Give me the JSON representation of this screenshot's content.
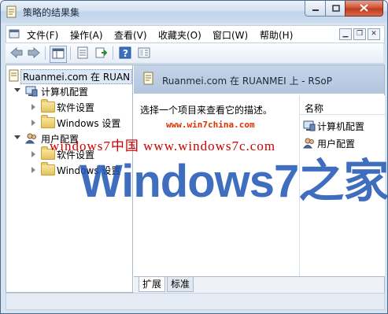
{
  "window": {
    "title": "策略的结果集"
  },
  "menu": {
    "items": [
      "文件(F)",
      "操作(A)",
      "查看(V)",
      "收藏夹(O)",
      "窗口(W)",
      "帮助(H)"
    ]
  },
  "toolbar": {
    "icons": [
      "back-icon",
      "forward-icon",
      "show-hide-tree-icon",
      "properties-icon",
      "export-icon",
      "help-icon",
      "view-icon"
    ]
  },
  "tree": {
    "root": "Ruanmei.com 在 RUAN",
    "computer_config": "计算机配置",
    "software_settings_1": "软件设置",
    "windows_settings_1": "Windows 设置",
    "user_config": "用户配置",
    "software_settings_2": "软件设置",
    "windows_settings_2": "Windows 设置"
  },
  "details": {
    "header_title": "Ruanmei.com 在 RUANMEI 上 - RSoP",
    "description": "选择一个项目来查看它的描述。",
    "list_column": "名称",
    "list_items": [
      "计算机配置",
      "用户配置"
    ]
  },
  "tabs": {
    "extended": "扩展",
    "standard": "标准"
  },
  "watermark": {
    "site": "www.win7china.com",
    "line": "windows7中国  www.windows7c.com",
    "logo": "Windows7之家"
  },
  "colors": {
    "accent": "#1f55b5",
    "header_band": "#b9cbe2",
    "close_button": "#c94a2c"
  }
}
